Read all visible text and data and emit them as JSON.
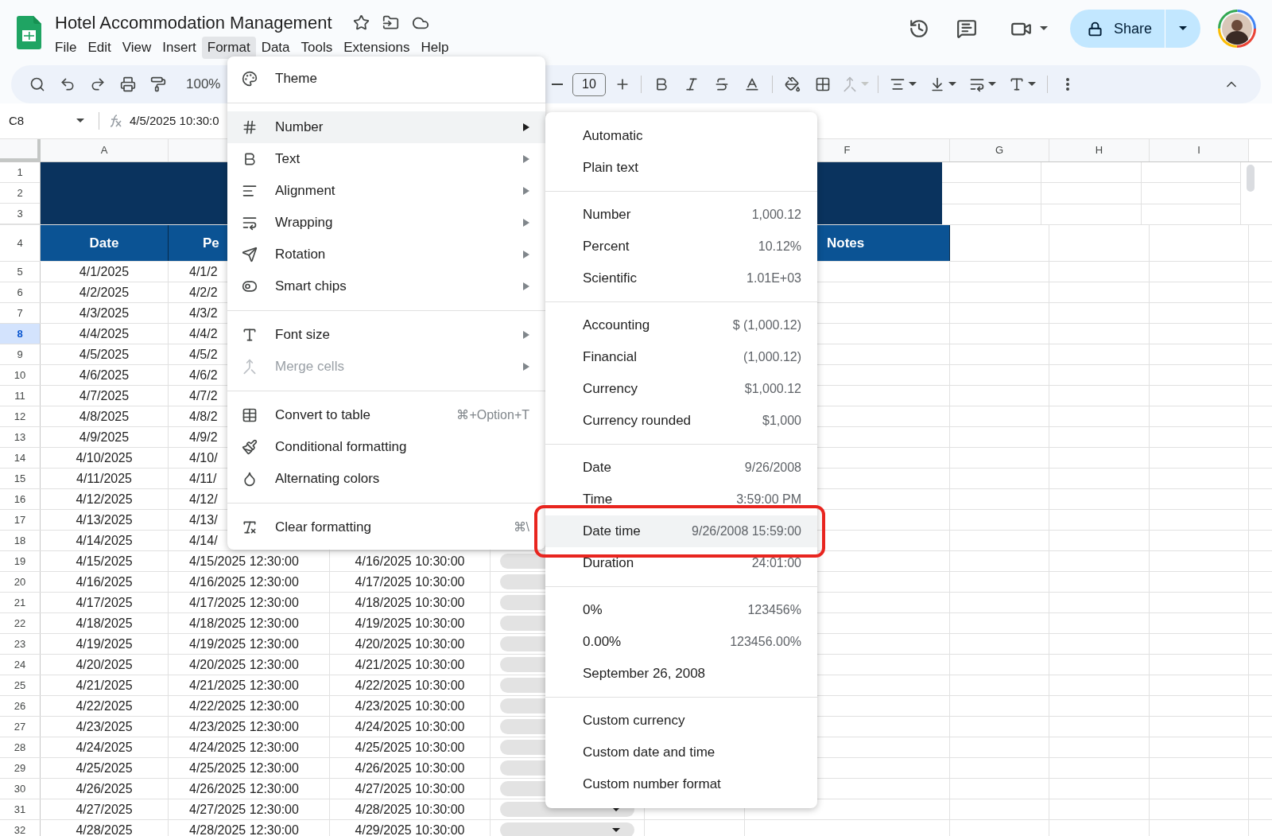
{
  "title": "Hotel Accommodation Management",
  "menu": [
    {
      "label": "File",
      "selected": false
    },
    {
      "label": "Edit",
      "selected": false
    },
    {
      "label": "View",
      "selected": false
    },
    {
      "label": "Insert",
      "selected": false
    },
    {
      "label": "Format",
      "selected": true
    },
    {
      "label": "Data",
      "selected": false
    },
    {
      "label": "Tools",
      "selected": false
    },
    {
      "label": "Extensions",
      "selected": false
    },
    {
      "label": "Help",
      "selected": false
    }
  ],
  "share": {
    "label": "Share"
  },
  "toolbar": {
    "zoom": "100%",
    "font_size": "10"
  },
  "formula_bar": {
    "cell": "C8",
    "value": "4/5/2025 10:30:0"
  },
  "column_headers": {
    "left": [
      "A"
    ],
    "right": [
      "F",
      "G",
      "H",
      "I"
    ]
  },
  "banner_rows": [
    "1",
    "2",
    "3"
  ],
  "header_row": {
    "number": "4",
    "date": "Date",
    "column_b": "Pe",
    "notes": "Notes"
  },
  "rows": [
    {
      "number": "5",
      "selected": false,
      "cells": [
        "4/1/2025",
        "4/1/2"
      ]
    },
    {
      "number": "6",
      "selected": false,
      "cells": [
        "4/2/2025",
        "4/2/2"
      ]
    },
    {
      "number": "7",
      "selected": false,
      "cells": [
        "4/3/2025",
        "4/3/2"
      ]
    },
    {
      "number": "8",
      "selected": true,
      "cells": [
        "4/4/2025",
        "4/4/2"
      ]
    },
    {
      "number": "9",
      "selected": false,
      "cells": [
        "4/5/2025",
        "4/5/2"
      ]
    },
    {
      "number": "10",
      "selected": false,
      "cells": [
        "4/6/2025",
        "4/6/2"
      ]
    },
    {
      "number": "11",
      "selected": false,
      "cells": [
        "4/7/2025",
        "4/7/2"
      ]
    },
    {
      "number": "12",
      "selected": false,
      "cells": [
        "4/8/2025",
        "4/8/2"
      ]
    },
    {
      "number": "13",
      "selected": false,
      "cells": [
        "4/9/2025",
        "4/9/2"
      ]
    },
    {
      "number": "14",
      "selected": false,
      "cells": [
        "4/10/2025",
        "4/10/"
      ]
    },
    {
      "number": "15",
      "selected": false,
      "cells": [
        "4/11/2025",
        "4/11/"
      ]
    },
    {
      "number": "16",
      "selected": false,
      "cells": [
        "4/12/2025",
        "4/12/"
      ]
    },
    {
      "number": "17",
      "selected": false,
      "cells": [
        "4/13/2025",
        "4/13/"
      ]
    },
    {
      "number": "18",
      "selected": false,
      "cells": [
        "4/14/2025",
        "4/14/"
      ]
    },
    {
      "number": "19",
      "selected": false,
      "dropdown": true,
      "cells": [
        "4/15/2025",
        "4/15/2025 12:30:00",
        "4/16/2025 10:30:00"
      ]
    },
    {
      "number": "20",
      "selected": false,
      "dropdown": true,
      "cells": [
        "4/16/2025",
        "4/16/2025 12:30:00",
        "4/17/2025 10:30:00"
      ]
    },
    {
      "number": "21",
      "selected": false,
      "dropdown": true,
      "cells": [
        "4/17/2025",
        "4/17/2025 12:30:00",
        "4/18/2025 10:30:00"
      ]
    },
    {
      "number": "22",
      "selected": false,
      "dropdown": true,
      "cells": [
        "4/18/2025",
        "4/18/2025 12:30:00",
        "4/19/2025 10:30:00"
      ]
    },
    {
      "number": "23",
      "selected": false,
      "dropdown": true,
      "cells": [
        "4/19/2025",
        "4/19/2025 12:30:00",
        "4/20/2025 10:30:00"
      ]
    },
    {
      "number": "24",
      "selected": false,
      "dropdown": true,
      "cells": [
        "4/20/2025",
        "4/20/2025 12:30:00",
        "4/21/2025 10:30:00"
      ]
    },
    {
      "number": "25",
      "selected": false,
      "dropdown": true,
      "cells": [
        "4/21/2025",
        "4/21/2025 12:30:00",
        "4/22/2025 10:30:00"
      ]
    },
    {
      "number": "26",
      "selected": false,
      "dropdown": true,
      "cells": [
        "4/22/2025",
        "4/22/2025 12:30:00",
        "4/23/2025 10:30:00"
      ]
    },
    {
      "number": "27",
      "selected": false,
      "dropdown": true,
      "cells": [
        "4/23/2025",
        "4/23/2025 12:30:00",
        "4/24/2025 10:30:00"
      ]
    },
    {
      "number": "28",
      "selected": false,
      "dropdown": true,
      "cells": [
        "4/24/2025",
        "4/24/2025 12:30:00",
        "4/25/2025 10:30:00"
      ]
    },
    {
      "number": "29",
      "selected": false,
      "dropdown": true,
      "cells": [
        "4/25/2025",
        "4/25/2025 12:30:00",
        "4/26/2025 10:30:00"
      ]
    },
    {
      "number": "30",
      "selected": false,
      "dropdown": true,
      "cells": [
        "4/26/2025",
        "4/26/2025 12:30:00",
        "4/27/2025 10:30:00"
      ]
    },
    {
      "number": "31",
      "selected": false,
      "dropdown": true,
      "dropdown_arrow": true,
      "cells": [
        "4/27/2025",
        "4/27/2025 12:30:00",
        "4/28/2025 10:30:00"
      ]
    },
    {
      "number": "32",
      "selected": false,
      "dropdown": true,
      "dropdown_arrow": true,
      "cells": [
        "4/28/2025",
        "4/28/2025 12:30:00",
        "4/29/2025 10:30:00"
      ]
    }
  ],
  "format_menu": {
    "sections": [
      [
        {
          "label": "Theme",
          "selected": false,
          "disabled": false,
          "submenu": false
        }
      ],
      [
        {
          "label": "Number",
          "selected": true,
          "disabled": false,
          "submenu": true
        },
        {
          "label": "Text",
          "selected": false,
          "disabled": false,
          "submenu": true
        },
        {
          "label": "Alignment",
          "selected": false,
          "disabled": false,
          "submenu": true
        },
        {
          "label": "Wrapping",
          "selected": false,
          "disabled": false,
          "submenu": true
        },
        {
          "label": "Rotation",
          "selected": false,
          "disabled": false,
          "submenu": true
        },
        {
          "label": "Smart chips",
          "selected": false,
          "disabled": false,
          "submenu": true
        }
      ],
      [
        {
          "label": "Font size",
          "selected": false,
          "disabled": false,
          "submenu": true
        },
        {
          "label": "Merge cells",
          "selected": false,
          "disabled": true,
          "submenu": true
        }
      ],
      [
        {
          "label": "Convert to table",
          "selected": false,
          "disabled": false,
          "submenu": false,
          "shortcut": "⌘+Option+T"
        },
        {
          "label": "Conditional formatting",
          "selected": false,
          "disabled": false,
          "submenu": false
        },
        {
          "label": "Alternating colors",
          "selected": false,
          "disabled": false,
          "submenu": false
        }
      ],
      [
        {
          "label": "Clear formatting",
          "selected": false,
          "disabled": false,
          "submenu": false,
          "shortcut": "⌘\\"
        }
      ]
    ]
  },
  "number_submenu": {
    "sections": [
      [
        {
          "label": "Automatic",
          "selected": false,
          "outlined": false
        },
        {
          "label": "Plain text",
          "selected": false,
          "outlined": false
        }
      ],
      [
        {
          "label": "Number",
          "example": "1,000.12",
          "selected": false,
          "outlined": false
        },
        {
          "label": "Percent",
          "example": "10.12%",
          "selected": false,
          "outlined": false
        },
        {
          "label": "Scientific",
          "example": "1.01E+03",
          "selected": false,
          "outlined": false
        }
      ],
      [
        {
          "label": "Accounting",
          "example": "$ (1,000.12)",
          "selected": false,
          "outlined": false
        },
        {
          "label": "Financial",
          "example": "(1,000.12)",
          "selected": false,
          "outlined": false
        },
        {
          "label": "Currency",
          "example": "$1,000.12",
          "selected": false,
          "outlined": false
        },
        {
          "label": "Currency rounded",
          "example": "$1,000",
          "selected": false,
          "outlined": false
        }
      ],
      [
        {
          "label": "Date",
          "example": "9/26/2008",
          "selected": false,
          "outlined": false
        },
        {
          "label": "Time",
          "example": "3:59:00 PM",
          "selected": false,
          "outlined": false
        },
        {
          "label": "Date time",
          "example": "9/26/2008 15:59:00",
          "selected": true,
          "outlined": true
        },
        {
          "label": "Duration",
          "example": "24:01:00",
          "selected": false,
          "outlined": false
        }
      ],
      [
        {
          "label": "0%",
          "example": "123456%",
          "selected": false,
          "outlined": false
        },
        {
          "label": "0.00%",
          "example": "123456.00%",
          "selected": false,
          "outlined": false
        },
        {
          "label": "September 26, 2008",
          "selected": false,
          "outlined": false
        }
      ],
      [
        {
          "label": "Custom currency",
          "selected": false,
          "outlined": false
        },
        {
          "label": "Custom date and time",
          "selected": false,
          "outlined": false
        },
        {
          "label": "Custom number format",
          "selected": false,
          "outlined": false
        }
      ]
    ]
  }
}
